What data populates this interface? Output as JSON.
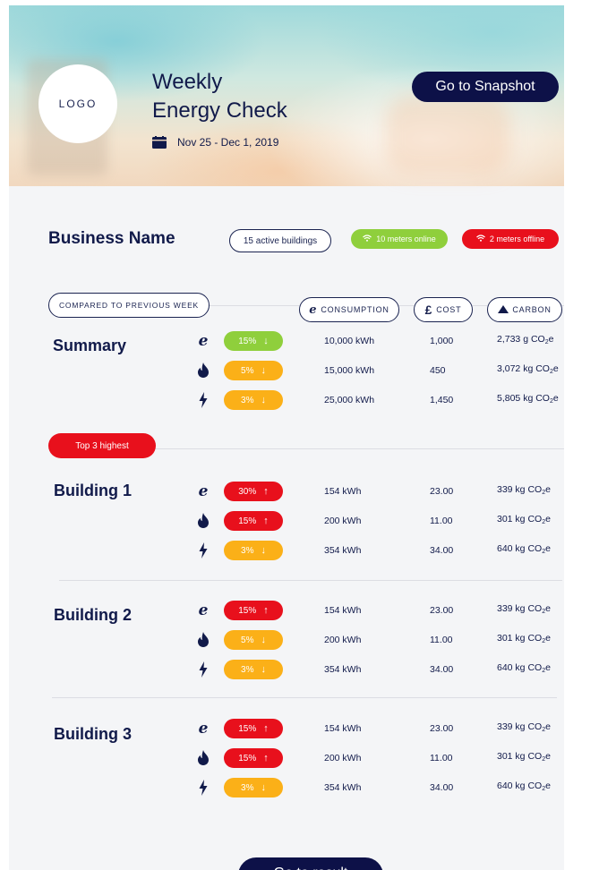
{
  "header": {
    "logo": "LOGO",
    "title_line1": "Weekly",
    "title_line2": "Energy Check",
    "date_range": "Nov 25 - Dec 1, 2019",
    "snapshot_button": "Go to Snapshot"
  },
  "business": {
    "name": "Business Name",
    "active_buildings": "15 active buildings",
    "meters_online": "10 meters online",
    "meters_offline": "2 meters offline"
  },
  "columns": {
    "compared": "COMPARED TO PREVIOUS WEEK",
    "consumption": "CONSUMPTION",
    "cost": "COST",
    "carbon": "CARBON"
  },
  "colors": {
    "navy": "#0d1148",
    "green": "#8fcf3c",
    "red": "#e8101c",
    "orange": "#fbb018"
  },
  "summary": {
    "label": "Summary",
    "rows": [
      {
        "icon": "electricity-e-icon",
        "change": "15%",
        "direction": "down",
        "color": "green",
        "consumption": "10,000 kWh",
        "cost": "1,000",
        "carbon": "2,733 g CO",
        "carbon_suffix": "e"
      },
      {
        "icon": "gas-flame-icon",
        "change": "5%",
        "direction": "down",
        "color": "orange",
        "consumption": "15,000 kWh",
        "cost": "450",
        "carbon": "3,072 kg CO",
        "carbon_suffix": "e"
      },
      {
        "icon": "lightning-bolt-icon",
        "change": "3%",
        "direction": "down",
        "color": "orange",
        "consumption": "25,000 kWh",
        "cost": "1,450",
        "carbon": "5,805 kg CO",
        "carbon_suffix": "e"
      }
    ]
  },
  "top3_label": "Top 3 highest",
  "buildings": [
    {
      "label": "Building 1",
      "rows": [
        {
          "change": "30%",
          "direction": "up",
          "color": "red",
          "consumption": "154 kWh",
          "cost": "23.00",
          "carbon": "339 kg CO",
          "carbon_suffix": "e"
        },
        {
          "change": "15%",
          "direction": "up",
          "color": "red",
          "consumption": "200 kWh",
          "cost": "11.00",
          "carbon": "301 kg CO",
          "carbon_suffix": "e"
        },
        {
          "change": "3%",
          "direction": "down",
          "color": "orange",
          "consumption": "354 kWh",
          "cost": "34.00",
          "carbon": "640 kg CO",
          "carbon_suffix": "e"
        }
      ]
    },
    {
      "label": "Building 2",
      "rows": [
        {
          "change": "15%",
          "direction": "up",
          "color": "red",
          "consumption": "154 kWh",
          "cost": "23.00",
          "carbon": "339 kg CO",
          "carbon_suffix": "e"
        },
        {
          "change": "5%",
          "direction": "down",
          "color": "orange",
          "consumption": "200 kWh",
          "cost": "11.00",
          "carbon": "301 kg CO",
          "carbon_suffix": "e"
        },
        {
          "change": "3%",
          "direction": "down",
          "color": "orange",
          "consumption": "354 kWh",
          "cost": "34.00",
          "carbon": "640 kg CO",
          "carbon_suffix": "e"
        }
      ]
    },
    {
      "label": "Building 3",
      "rows": [
        {
          "change": "15%",
          "direction": "up",
          "color": "red",
          "consumption": "154 kWh",
          "cost": "23.00",
          "carbon": "339 kg CO",
          "carbon_suffix": "e"
        },
        {
          "change": "15%",
          "direction": "up",
          "color": "red",
          "consumption": "200 kWh",
          "cost": "11.00",
          "carbon": "301 kg CO",
          "carbon_suffix": "e"
        },
        {
          "change": "3%",
          "direction": "down",
          "color": "orange",
          "consumption": "354 kWh",
          "cost": "34.00",
          "carbon": "640 kg CO",
          "carbon_suffix": "e"
        }
      ]
    }
  ],
  "footer_button": "Go to result"
}
